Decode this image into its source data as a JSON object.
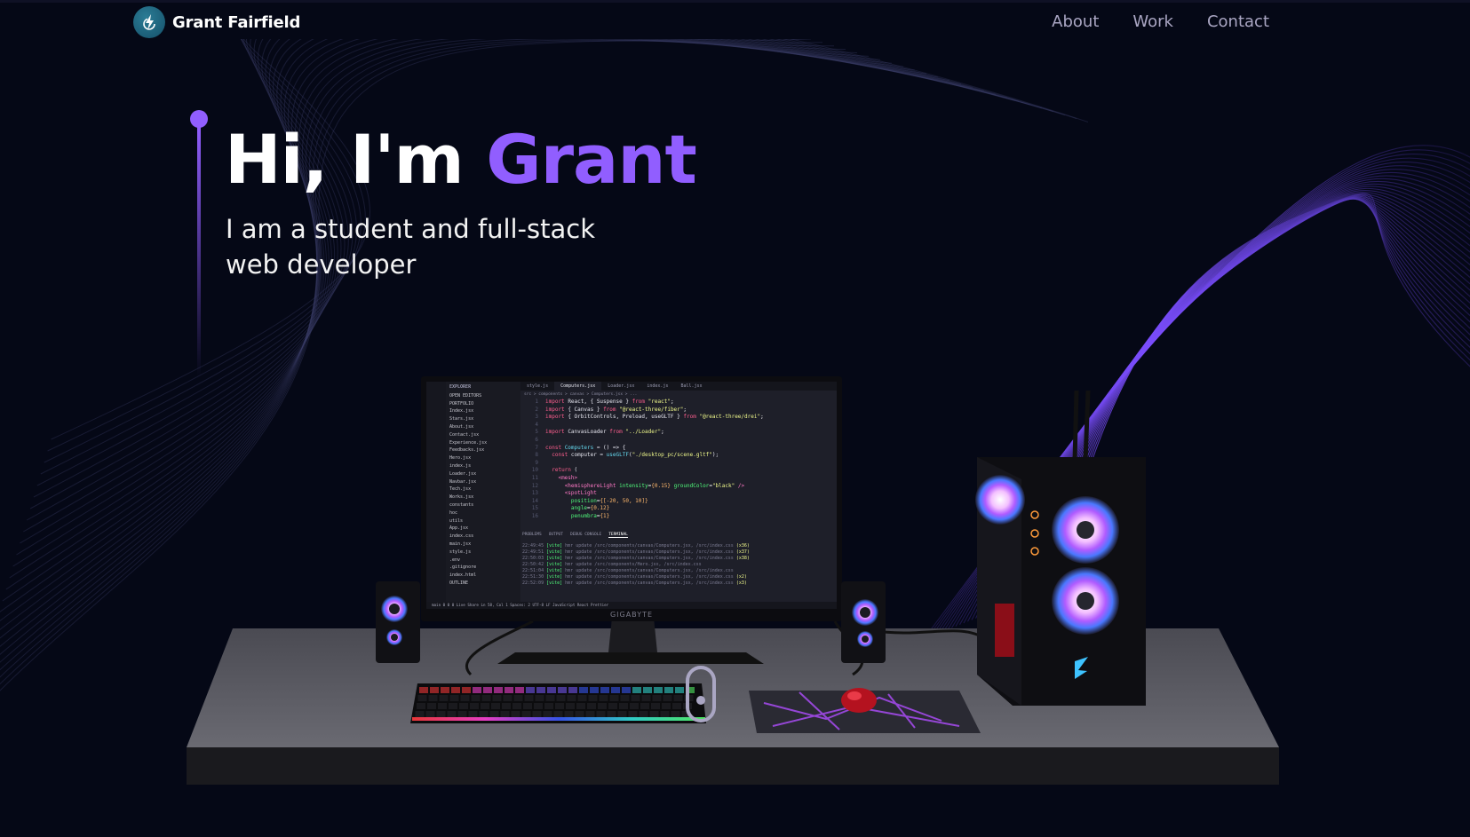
{
  "nav": {
    "brand": "Grant Fairfield",
    "links": [
      {
        "label": "About"
      },
      {
        "label": "Work"
      },
      {
        "label": "Contact"
      }
    ]
  },
  "hero": {
    "greeting": "Hi, I'm ",
    "name": "Grant",
    "subtitle": "I am a student and full-stack web developer"
  },
  "editor": {
    "explorer_title": "EXPLORER",
    "open_editors": "OPEN EDITORS",
    "project": "PORTFOLIO",
    "files": [
      "Index.jsx",
      "Stars.jsx",
      "About.jsx",
      "Contact.jsx",
      "Experience.jsx",
      "Feedbacks.jsx",
      "Hero.jsx",
      "index.js",
      "Loader.jsx",
      "Navbar.jsx",
      "Tech.jsx",
      "Works.jsx",
      "constants",
      "hoc",
      "utils",
      "App.jsx",
      "index.css",
      "main.jsx",
      "style.js",
      ".env",
      ".gitignore",
      "index.html"
    ],
    "outline": "OUTLINE",
    "tabs": [
      "style.js",
      "Computers.jsx",
      "Loader.jsx",
      "index.js",
      "Ball.jsx"
    ],
    "active_tab": "Computers.jsx",
    "breadcrumb": "src > components > canvas > Computers.jsx > ...",
    "panel_tabs": [
      "PROBLEMS",
      "OUTPUT",
      "DEBUG CONSOLE",
      "TERMINAL"
    ],
    "active_panel": "TERMINAL",
    "status": "main   0  0  0   Live Share                                     Ln 58, Col 1   Spaces: 2   UTF-8   LF   JavaScript React   Prettier",
    "monitor_brand": "GIGABYTE"
  },
  "colors": {
    "background": "#050816",
    "accent": "#915eff",
    "nav_text": "#aaa6c3"
  },
  "icons": {
    "logo": "grant-logo-icon",
    "scroll": "scroll-mouse-icon"
  }
}
